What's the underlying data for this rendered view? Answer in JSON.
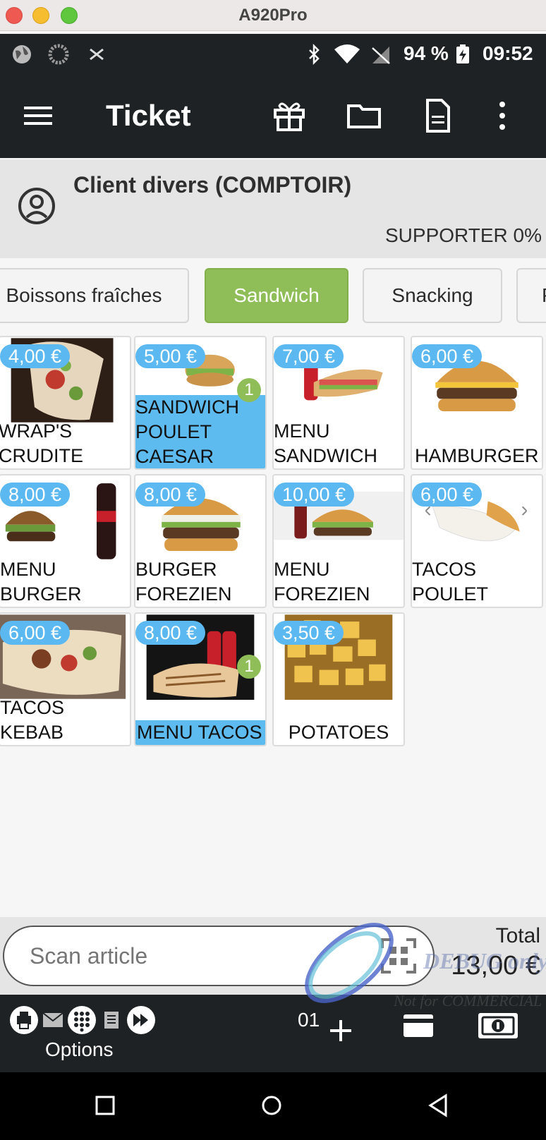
{
  "window": {
    "title": "A920Pro"
  },
  "status_bar": {
    "battery": "94 %",
    "time": "09:52"
  },
  "app_bar": {
    "title": "Ticket"
  },
  "client": {
    "name": "Client divers (COMPTOIR)",
    "rate": "SUPPORTER 0%"
  },
  "categories": [
    {
      "label": "Boissons fraîches"
    },
    {
      "label": "Sandwich"
    },
    {
      "label": "Snacking"
    },
    {
      "label": "P"
    }
  ],
  "products": [
    {
      "price": "4,00 €",
      "name": "WRAP'S\nCRUDITE"
    },
    {
      "price": "5,00 €",
      "name": "SANDWICH\nPOULET\nCAESAR",
      "qty": "1"
    },
    {
      "price": "7,00 €",
      "name": "MENU\nSANDWICH"
    },
    {
      "price": "6,00 €",
      "name": "HAMBURGER"
    },
    {
      "price": "8,00 €",
      "name": "MENU\nBURGER"
    },
    {
      "price": "8,00 €",
      "name": "BURGER\nFOREZIEN"
    },
    {
      "price": "10,00 €",
      "name": "MENU\nFOREZIEN"
    },
    {
      "price": "6,00 €",
      "name": "TACOS\nPOULET"
    },
    {
      "price": "6,00 €",
      "name": "TACOS\nKEBAB"
    },
    {
      "price": "8,00 €",
      "name": "MENU TACOS",
      "qty": "1"
    },
    {
      "price": "3,50 €",
      "name": "POTATOES"
    }
  ],
  "scan": {
    "placeholder": "Scan article"
  },
  "total": {
    "label": "Total",
    "value": "13,00 €"
  },
  "toolbar": {
    "options_label": "Options",
    "counter": "01"
  },
  "watermark": {
    "line1": "DEBUG only",
    "line2": "Not for COMMERCIAL"
  },
  "colors": {
    "dark": "#1e2224",
    "accent_green": "#8fbd57",
    "price_blue": "#5bb8f0"
  }
}
